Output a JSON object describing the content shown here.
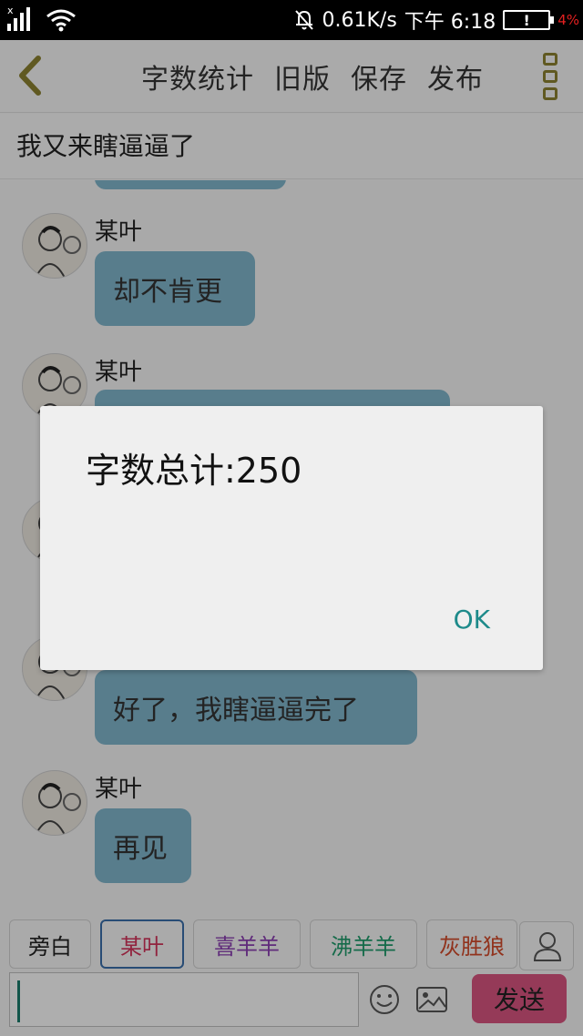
{
  "status_bar": {
    "network_type": "x",
    "speed": "0.61K/s",
    "time": "下午 6:18",
    "battery_mark": "!",
    "battery_percent": "4%",
    "icons": [
      "signal-icon",
      "wifi-icon",
      "bell-off-icon",
      "battery-icon"
    ]
  },
  "nav": {
    "items": [
      "字数统计",
      "旧版",
      "保存",
      "发布"
    ],
    "icons": [
      "back-arrow-icon",
      "more-icon"
    ]
  },
  "story": {
    "title": "我又来瞎逼逼了"
  },
  "messages": [
    {
      "speaker": "某叶",
      "text": "却不肯更"
    },
    {
      "speaker": "某叶",
      "text": ""
    },
    {
      "speaker": "",
      "text": "好了，我瞎逼逼完了"
    },
    {
      "speaker": "某叶",
      "text": "再见"
    }
  ],
  "roles": {
    "items": [
      {
        "label": "旁白",
        "color": "#333333"
      },
      {
        "label": "某叶",
        "color": "#d0335a"
      },
      {
        "label": "喜羊羊",
        "color": "#8a3fb0"
      },
      {
        "label": "沸羊羊",
        "color": "#1f9a6a"
      },
      {
        "label": "灰胜狼",
        "color": "#d04a2a"
      }
    ],
    "selected": "某叶"
  },
  "input": {
    "value": "",
    "send_label": "发送"
  },
  "dialog": {
    "message": "字数总计:250",
    "ok_label": "OK"
  },
  "colors": {
    "bubble": "#7fb3c9",
    "send": "#d6547e",
    "ok": "#1d8a8a"
  }
}
